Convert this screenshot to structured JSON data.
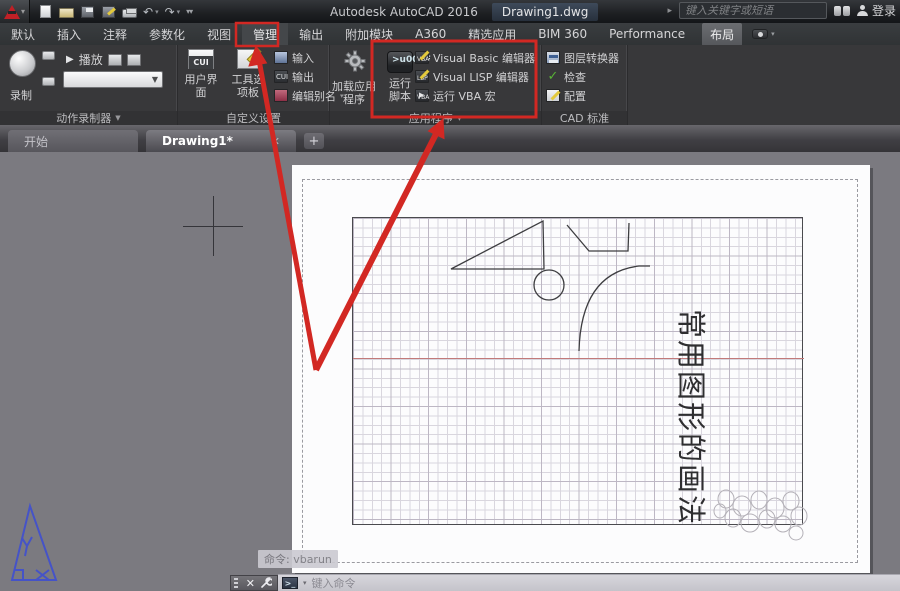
{
  "window": {
    "title_app": "Autodesk AutoCAD 2016",
    "title_doc": "Drawing1.dwg",
    "search_placeholder": "键入关键字或短语",
    "sign_in": "登录"
  },
  "ribbon": {
    "tabs": [
      "默认",
      "插入",
      "注释",
      "参数化",
      "视图",
      "管理",
      "输出",
      "附加模块",
      "A360",
      "精选应用",
      "BIM 360",
      "Performance",
      "布局"
    ],
    "active_tab": "管理",
    "panels": [
      {
        "label": "动作录制器",
        "record": "录制",
        "play": "播放"
      },
      {
        "label": "自定义设置",
        "cui_badge": "CUI",
        "big_items": [
          "用户界面",
          "工具选项板"
        ],
        "rows": [
          "输入",
          "输出",
          "编辑别名"
        ]
      },
      {
        "label": "应用程序",
        "big_items": [
          "加载应用程序",
          "运行脚本"
        ],
        "rows": [
          "Visual Basic 编辑器",
          "Visual LISP 编辑器",
          "运行 VBA 宏"
        ]
      },
      {
        "label": "CAD 标准",
        "rows": [
          "图层转换器",
          "检查",
          "配置"
        ]
      }
    ]
  },
  "file_tabs": {
    "start": "开始",
    "active": "Drawing1*"
  },
  "drawing": {
    "vertical_text": "常用图形的画法",
    "command_ghost": "命令: vbarun"
  },
  "command_bar": {
    "prompt": ">_",
    "placeholder": "键入命令"
  },
  "glyphs": {
    "caret_down": "▼",
    "caret_small": "▾",
    "play": "▶",
    "check": "✓",
    "close": "✕",
    "plus": "+",
    "flyout": "▸"
  },
  "colors": {
    "annotation_red": "#d22823",
    "ucs_blue": "#4553c8",
    "guide_red": "#c27a7a"
  }
}
